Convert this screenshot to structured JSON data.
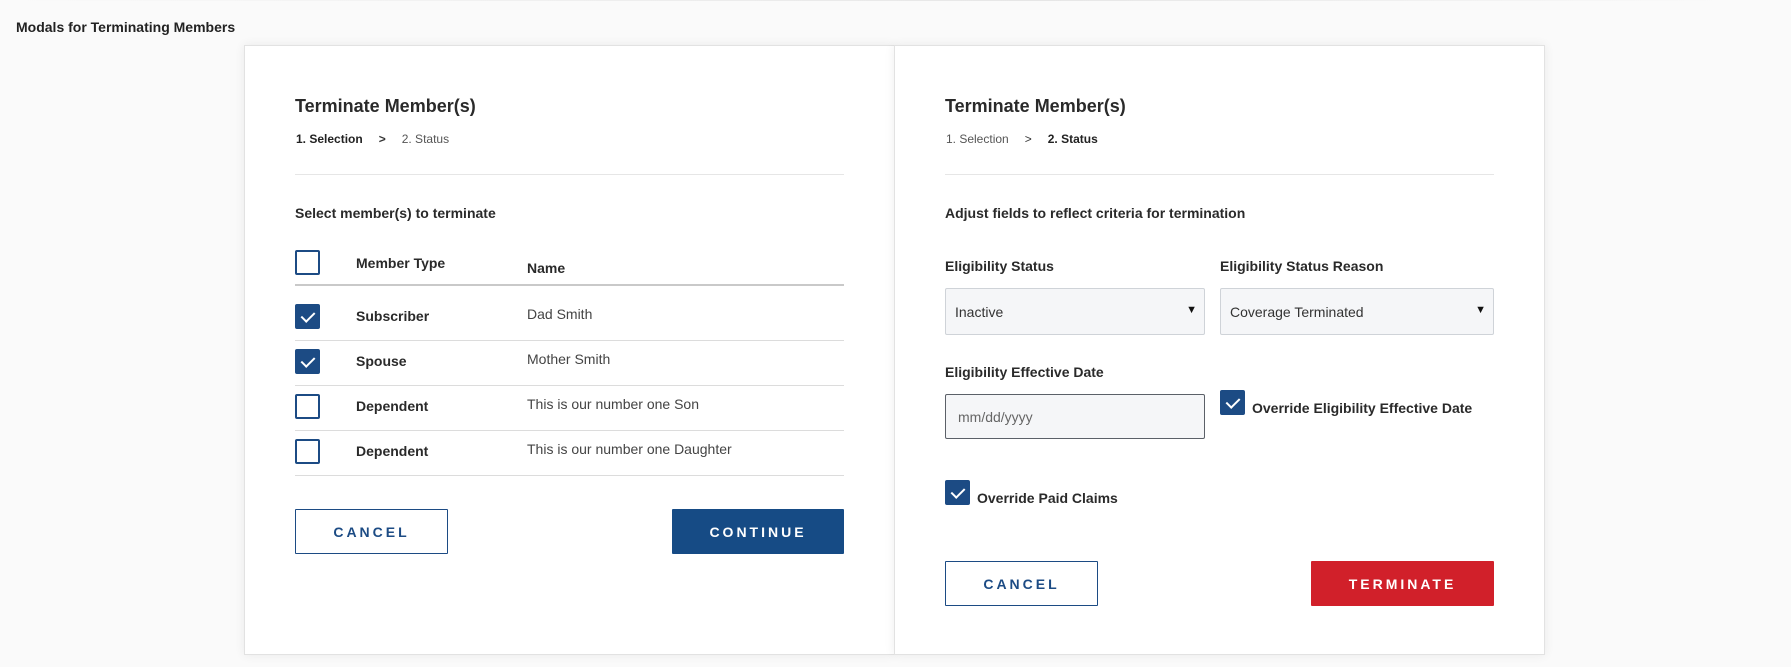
{
  "page_title": "Modals for Terminating Members",
  "colors": {
    "primary": "#164b85",
    "danger": "#d1202a"
  },
  "left_modal": {
    "title": "Terminate Member(s)",
    "steps": [
      "1. Selection",
      ">",
      "2. Status"
    ],
    "active_step": 0,
    "prompt": "Select member(s) to terminate",
    "headers": {
      "type": "Member Type",
      "name": "Name"
    },
    "select_all_checked": false,
    "rows": [
      {
        "type": "Subscriber",
        "name": "Dad Smith",
        "checked": true
      },
      {
        "type": "Spouse",
        "name": "Mother Smith",
        "checked": true
      },
      {
        "type": "Dependent",
        "name": "This is our number one Son",
        "checked": false
      },
      {
        "type": "Dependent",
        "name": "This is our number one Daughter",
        "checked": false
      }
    ],
    "cancel_label": "CANCEL",
    "continue_label": "CONTINUE"
  },
  "right_modal": {
    "title": "Terminate Member(s)",
    "steps": [
      "1. Selection",
      ">",
      "2. Status"
    ],
    "active_step": 1,
    "prompt": "Adjust fields to reflect criteria for termination",
    "eligibility_status": {
      "label": "Eligibility Status",
      "value": "Inactive"
    },
    "eligibility_status_reason": {
      "label": "Eligibility Status Reason",
      "value": "Coverage Terminated"
    },
    "eligibility_effective_date": {
      "label": "Eligibility Effective Date",
      "value": "",
      "placeholder": "mm/dd/yyyy"
    },
    "override_effective_date": {
      "label": "Override Eligibility Effective Date",
      "checked": true
    },
    "override_paid_claims": {
      "label": "Override Paid Claims",
      "checked": true
    },
    "cancel_label": "CANCEL",
    "terminate_label": "TERMINATE",
    "dropdown_arrow": "▼"
  }
}
